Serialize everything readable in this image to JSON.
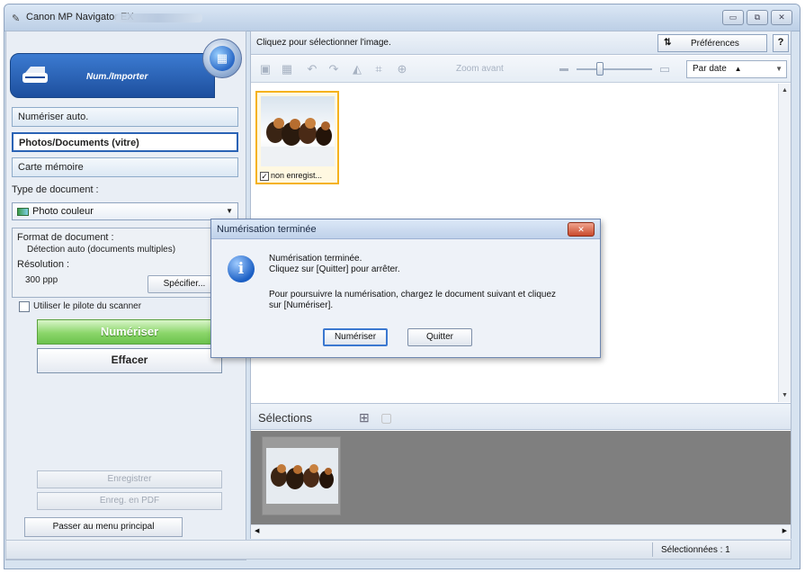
{
  "window": {
    "title": "Canon MP Navigator EX"
  },
  "left_panel": {
    "header_label": "Num./Importer",
    "modes": [
      {
        "label": "Numériser auto."
      },
      {
        "label": "Photos/Documents (vitre)"
      },
      {
        "label": "Carte mémoire"
      }
    ],
    "doc_type_label": "Type de document :",
    "doc_type_value": "Photo couleur",
    "doc_format_label": "Format de document :",
    "doc_format_value": "Détection auto (documents multiples)",
    "resolution_label": "Résolution :",
    "resolution_value": "300 ppp",
    "specify_label": "Spécifier...",
    "use_driver_label": "Utiliser le pilote du scanner",
    "scan_label": "Numériser",
    "clear_label": "Effacer",
    "save_label": "Enregistrer",
    "save_pdf_label": "Enreg. en PDF",
    "main_menu_label": "Passer au menu principal"
  },
  "content": {
    "instruction": "Cliquez pour sélectionner l'image.",
    "preferences_label": "Préférences",
    "help_label": "?",
    "zoom_label": "Zoom avant",
    "sort_value": "Par date",
    "thumbnail_caption": "non enregist...",
    "selections_title": "Sélections"
  },
  "status": {
    "selected": "Sélectionnées : 1"
  },
  "dialog": {
    "title": "Numérisation terminée",
    "line1": "Numérisation terminée.",
    "line2": "Cliquez sur [Quitter] pour arrêter.",
    "line3": "Pour poursuivre la numérisation, chargez le document suivant et cliquez",
    "line4": "sur [Numériser].",
    "scan_button": "Numériser",
    "quit_button": "Quitter"
  },
  "colors": {
    "accent_blue": "#1d4f9e",
    "scan_green": "#6cc24d",
    "selection_orange": "#f5b21d"
  }
}
